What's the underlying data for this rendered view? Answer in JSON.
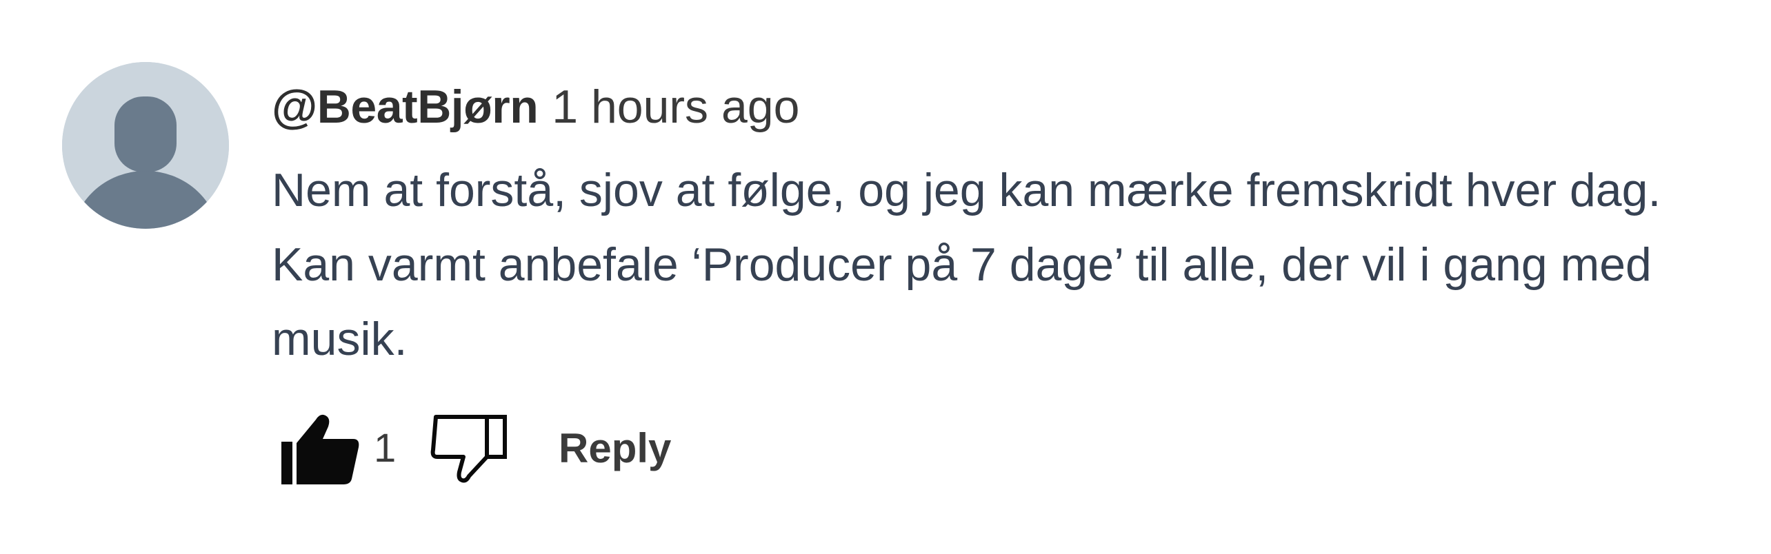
{
  "comment": {
    "username": "@BeatBjørn",
    "timestamp": "1 hours ago",
    "text": "Nem at forstå, sjov at følge, og jeg kan mærke fremskridt hver dag. Kan varmt anbefale ‘Producer på 7 dage’ til alle, der vil i gang med musik.",
    "like_count": "1",
    "reply_label": "Reply",
    "avatar_icon": "default-user-avatar-icon",
    "like_icon": "thumbs-up-filled-icon",
    "dislike_icon": "thumbs-down-outline-icon"
  },
  "colors": {
    "avatar_bg": "#cbd5dd",
    "avatar_fg": "#6a7b8c",
    "text": "#364152"
  }
}
